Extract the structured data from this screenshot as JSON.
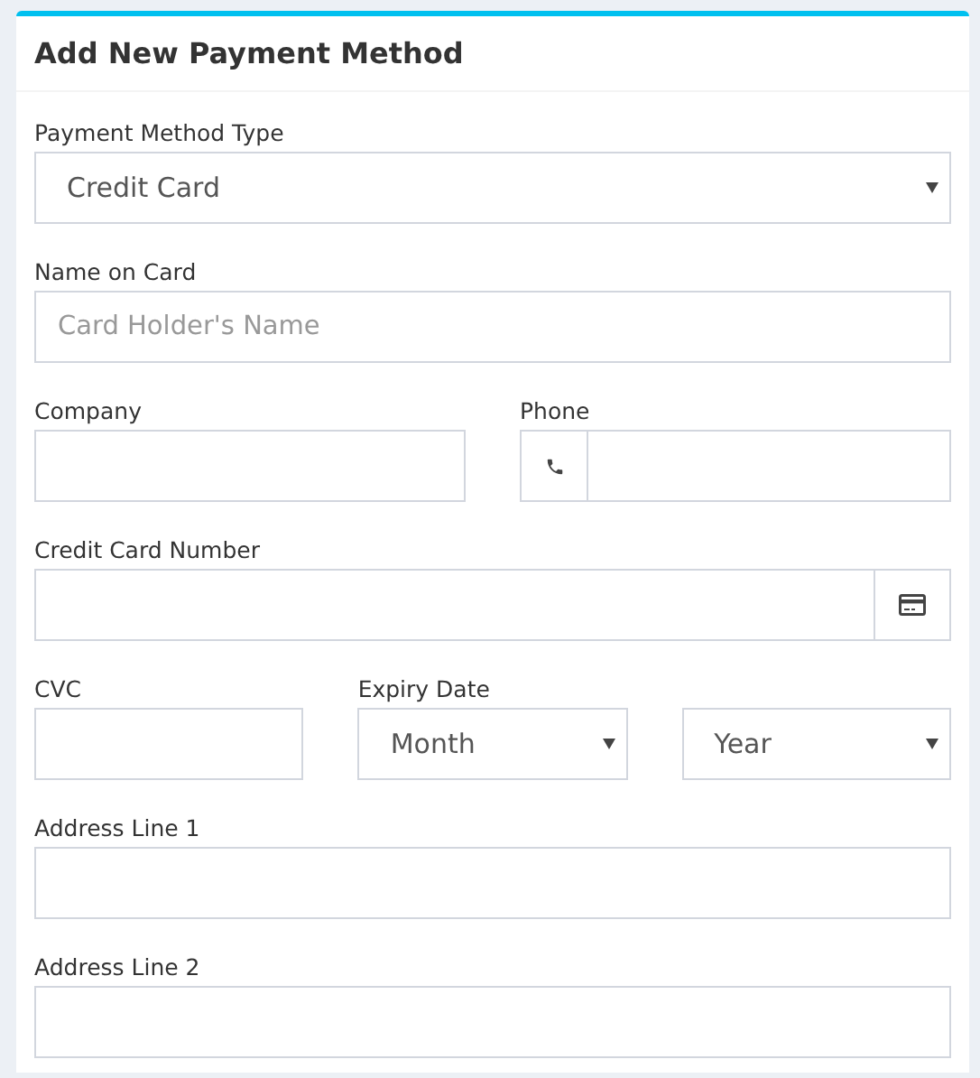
{
  "title": "Add New Payment Method",
  "rows": [
    {
      "fields": [
        {
          "kind": "select",
          "label": "Payment Method Type",
          "value": "Credit Card"
        }
      ]
    },
    {
      "fields": [
        {
          "kind": "text",
          "label": "Name on Card",
          "placeholder": "Card Holder's Name"
        }
      ]
    },
    {
      "fields": [
        {
          "kind": "text",
          "label": "Company"
        },
        {
          "kind": "phone",
          "label": "Phone"
        }
      ]
    },
    {
      "fields": [
        {
          "kind": "card",
          "label": "Credit Card Number"
        }
      ]
    },
    {
      "fields": [
        {
          "kind": "text",
          "label": "CVC"
        },
        {
          "kind": "select",
          "label": "Expiry Date",
          "value": "Month"
        },
        {
          "kind": "select",
          "value": "Year"
        }
      ]
    },
    {
      "fields": [
        {
          "kind": "text",
          "label": "Address Line 1"
        }
      ]
    },
    {
      "fields": [
        {
          "kind": "text",
          "label": "Address Line 2"
        }
      ]
    }
  ]
}
